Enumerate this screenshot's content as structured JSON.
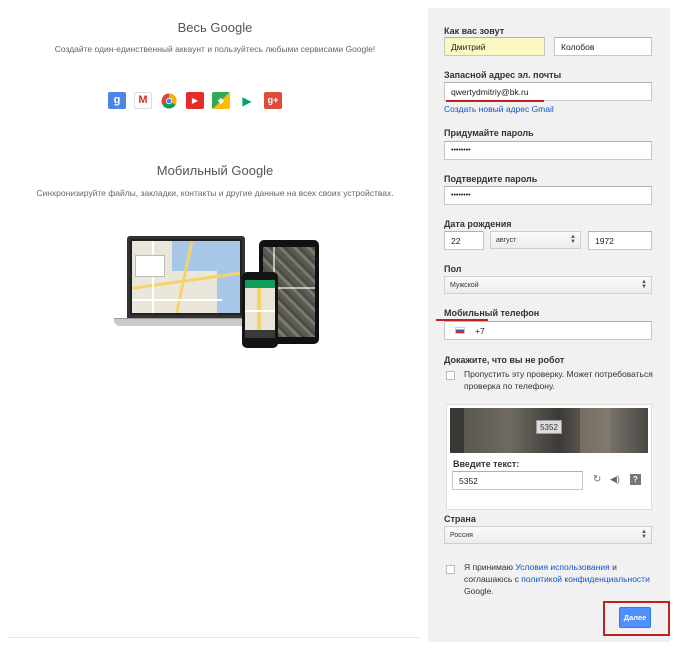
{
  "left": {
    "all_title": "Весь Google",
    "all_desc": "Создайте один-единственный аккаунт и пользуйтесь любыми сервисами Google!",
    "mobile_title": "Мобильный Google",
    "mobile_desc": "Синхронизируйте файлы, закладки, контакты и другие данные на всех своих устройствах.",
    "apps": [
      {
        "icon": "google-search-icon",
        "glyph": "g",
        "color": "#4285f4"
      },
      {
        "icon": "gmail-icon",
        "glyph": "M",
        "color": "#d93025"
      },
      {
        "icon": "chrome-icon",
        "glyph": "",
        "color": "#db4437"
      },
      {
        "icon": "youtube-icon",
        "glyph": "▶",
        "color": "#e52d27"
      },
      {
        "icon": "maps-icon",
        "glyph": "◆",
        "color": "#34a853"
      },
      {
        "icon": "play-icon",
        "glyph": "▶",
        "color": "#00a173"
      },
      {
        "icon": "google-plus-icon",
        "glyph": "g+",
        "color": "#dd4b39"
      }
    ]
  },
  "form": {
    "name_label": "Как вас зовут",
    "first_name": "Дмитрий",
    "last_name": "Колобов",
    "email_label": "Запасной адрес эл. почты",
    "email_value": "qwertydmitriy@bk.ru",
    "gmail_link": "Создать новый адрес Gmail",
    "password_label": "Придумайте пароль",
    "password_value": "••••••••",
    "confirm_label": "Подтвердите пароль",
    "confirm_value": "••••••••",
    "birth_label": "Дата рождения",
    "birth_day": "22",
    "birth_month": "август",
    "birth_year": "1972",
    "gender_label": "Пол",
    "gender_value": "Мужской",
    "phone_label": "Мобильный телефон",
    "phone_value": "+7",
    "robot_label": "Докажите, что вы не робот",
    "skip_text": "Пропустить эту проверку. Может потребоваться проверка по телефону.",
    "captcha_image_text": "5352",
    "captcha_label": "Введите текст:",
    "captcha_value": "5352",
    "country_label": "Страна",
    "country_value": "Россия",
    "terms_pre": "Я принимаю",
    "terms_link": "Условия использования",
    "terms_mid": "и соглашаюсь с",
    "privacy_link": "политикой конфиденциальности",
    "terms_post": "Google.",
    "next_button": "Далее",
    "accent": "#4d90fe",
    "highlight": "#b22222"
  }
}
